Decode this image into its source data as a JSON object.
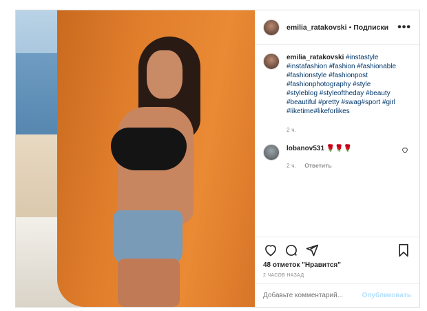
{
  "post": {
    "username": "emilia_ratakovski",
    "separator": "•",
    "follow_label": "Подписки",
    "more_label": "•••",
    "caption": {
      "username": "emilia_ratakovski",
      "hashtags": "#instastyle #instafashion #fashion #fashionable #fashionstyle #fashionpost #fashionphotography #style #styleblog #styleoftheday #beauty #beautiful #pretty #swag#sport #girl #liketime#likeforlikes",
      "time": "2 ч."
    },
    "comments": [
      {
        "username": "lobanov531",
        "text": "🌹🌹🌹",
        "time": "2 ч.",
        "reply_label": "Ответить"
      }
    ],
    "likes": "48 отметок \"Нравится\"",
    "timestamp": "2 ЧАСОВ НАЗАД",
    "add_comment_placeholder": "Добавьте комментарий...",
    "publish_label": "Опубликовать"
  },
  "icons": {
    "like": "heart-icon",
    "comment": "comment-icon",
    "share": "share-icon",
    "save": "bookmark-icon",
    "comment_like": "heart-icon",
    "more": "more-icon"
  }
}
